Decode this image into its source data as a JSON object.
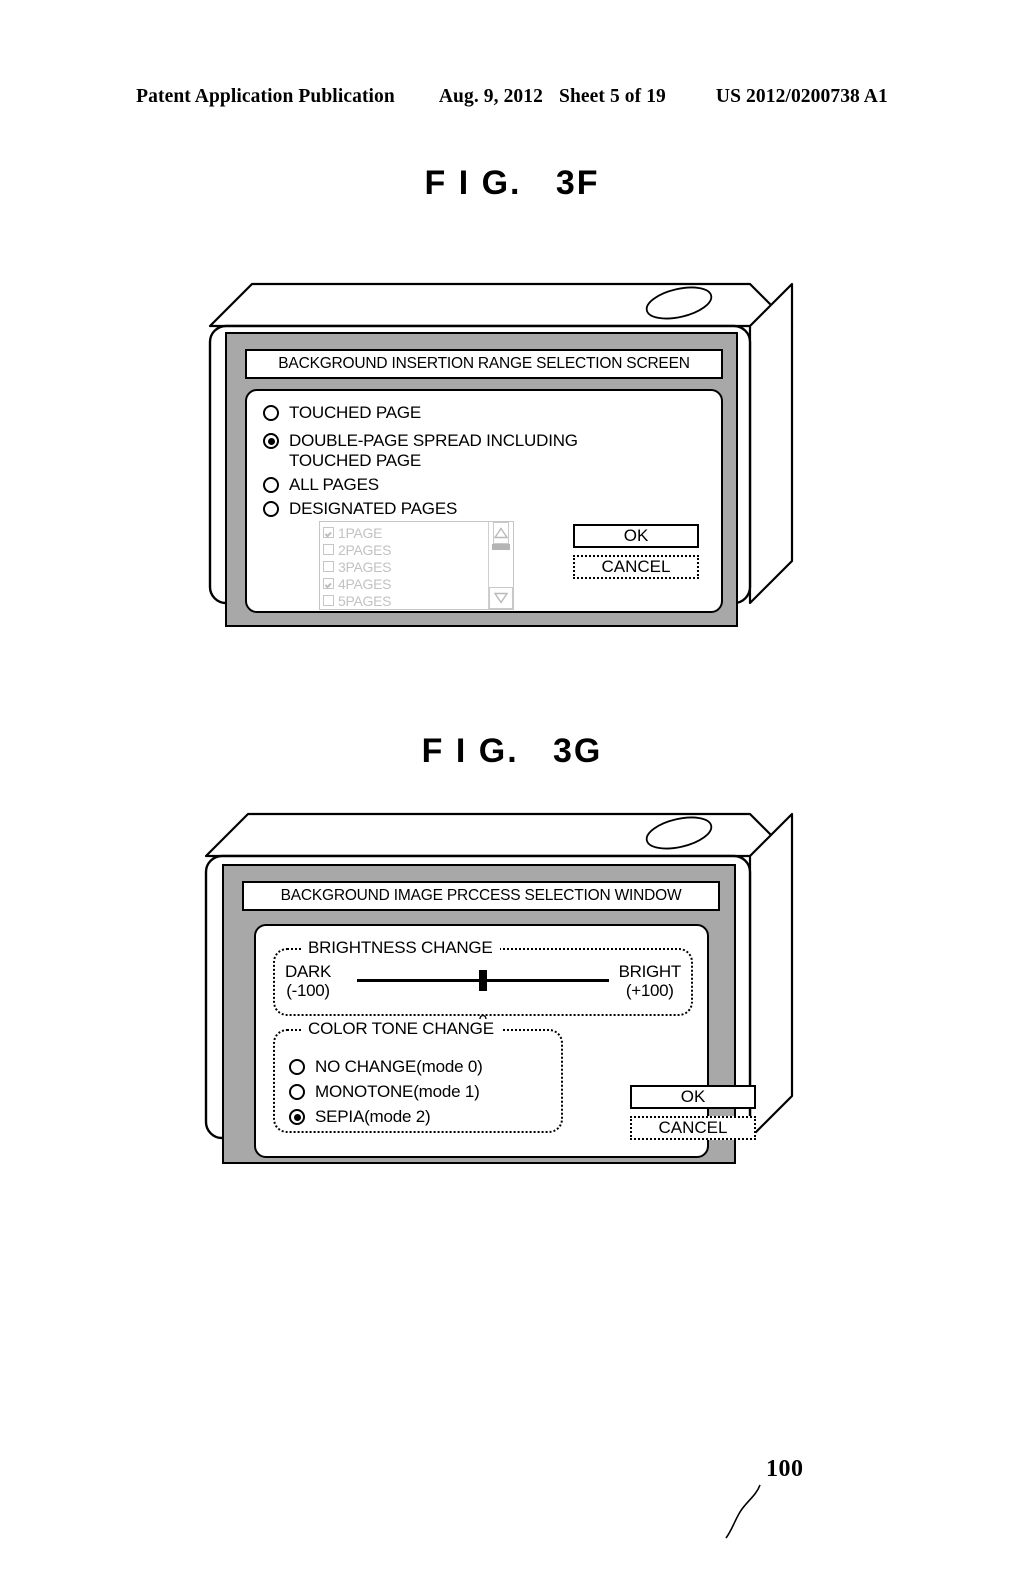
{
  "header": {
    "publication": "Patent Application Publication",
    "date": "Aug. 9, 2012",
    "sheet": "Sheet 5 of 19",
    "doc_number": "US 2012/0200738 A1"
  },
  "figures": [
    {
      "caption": "F I G.   3F",
      "reference_numeral": "100",
      "dialog": {
        "title": "BACKGROUND INSERTION RANGE SELECTION SCREEN",
        "options": [
          {
            "label": "TOUCHED PAGE",
            "label_line2": "",
            "selected": false
          },
          {
            "label": "DOUBLE-PAGE SPREAD INCLUDING",
            "label_line2": "TOUCHED PAGE",
            "selected": true
          },
          {
            "label": "ALL PAGES",
            "label_line2": "",
            "selected": false
          },
          {
            "label": "DESIGNATED PAGES",
            "label_line2": "",
            "selected": false
          }
        ],
        "page_list": {
          "enabled": false,
          "items": [
            {
              "label": "1PAGE",
              "checked": true
            },
            {
              "label": "2PAGES",
              "checked": false
            },
            {
              "label": "3PAGES",
              "checked": false
            },
            {
              "label": "4PAGES",
              "checked": true
            },
            {
              "label": "5PAGES",
              "checked": false
            }
          ],
          "scroll_up_icon": "triangle-up-icon",
          "scroll_down_icon": "triangle-down-icon"
        },
        "ok_label": "OK",
        "cancel_label": "CANCEL"
      }
    },
    {
      "caption": "F I G.   3G",
      "reference_numeral": "100",
      "dialog": {
        "title": "BACKGROUND IMAGE PRCCESS SELECTION WINDOW",
        "brightness": {
          "legend": "BRIGHTNESS CHANGE",
          "left_label": "DARK",
          "left_value": "(-100)",
          "right_label": "BRIGHT",
          "right_value": "(+100)",
          "current_value": "0",
          "min": -100,
          "max": 100
        },
        "color_tone": {
          "legend": "COLOR TONE CHANGE",
          "options": [
            {
              "label": "NO CHANGE(mode 0)",
              "selected": false
            },
            {
              "label": "MONOTONE(mode 1)",
              "selected": false
            },
            {
              "label": "SEPIA(mode 2)",
              "selected": true
            }
          ]
        },
        "ok_label": "OK",
        "cancel_label": "CANCEL"
      }
    }
  ],
  "colors": {
    "ink": "#000000",
    "bezel_grey": "#a8a8a8",
    "disabled_grey": "#c2c2c2",
    "paper": "#ffffff"
  }
}
